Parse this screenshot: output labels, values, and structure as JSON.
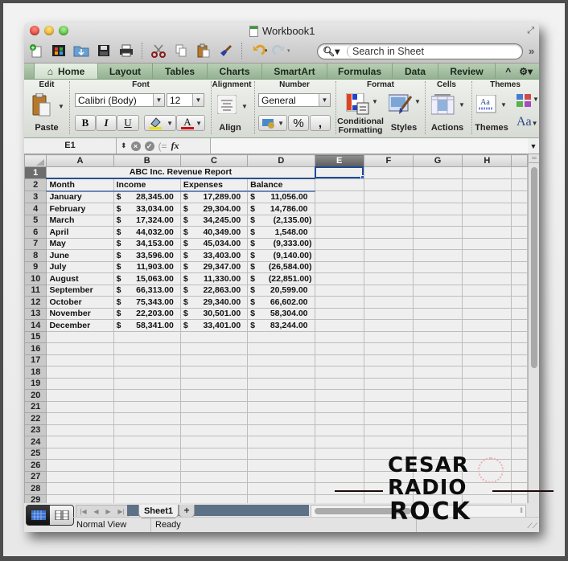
{
  "window": {
    "title": "Workbook1"
  },
  "toolbar": {
    "icons": [
      "new-workbook-icon",
      "gallery-icon",
      "open-icon",
      "save-icon",
      "print-icon",
      "cut-icon",
      "copy-icon",
      "paste-icon",
      "format-painter-icon",
      "undo-icon",
      "redo-icon"
    ],
    "search_placeholder": "Search in Sheet",
    "more": "»"
  },
  "ribbon_tabs": {
    "tabs": [
      "Home",
      "Layout",
      "Tables",
      "Charts",
      "SmartArt",
      "Formulas",
      "Data",
      "Review"
    ],
    "active": "Home",
    "collapse": "^",
    "gear": "⚙"
  },
  "ribbon": {
    "groups": {
      "edit": "Edit",
      "font": "Font",
      "alignment": "Alignment",
      "number": "Number",
      "format": "Format",
      "cells": "Cells",
      "themes": "Themes"
    },
    "paste_label": "Paste",
    "font_name": "Calibri (Body)",
    "font_size": "12",
    "bold": "B",
    "italic": "I",
    "underline": "U",
    "fill_color": "#f2e200",
    "font_color": "#d01010",
    "align_label": "Align",
    "number_format": "General",
    "percent": "%",
    "comma": ",",
    "conditional_formatting_1": "Conditional",
    "conditional_formatting_2": "Formatting",
    "styles_label": "Styles",
    "actions_label": "Actions",
    "themes_label": "Themes",
    "theme_fonts": "Aa"
  },
  "formula_bar": {
    "name_box": "E1",
    "fx": "fx",
    "value": ""
  },
  "sheet": {
    "columns": [
      "A",
      "B",
      "C",
      "D",
      "E",
      "F",
      "G",
      "H"
    ],
    "selected_column": "E",
    "selected_cell": "E1",
    "title": "ABC Inc. Revenue Report",
    "headers": [
      "Month",
      "Income",
      "Expenses",
      "Balance"
    ],
    "currency_symbol": "$",
    "rows": [
      {
        "month": "January",
        "income": "28,345.00",
        "expenses": "17,289.00",
        "balance": "11,056.00"
      },
      {
        "month": "February",
        "income": "33,034.00",
        "expenses": "29,304.00",
        "balance": "14,786.00"
      },
      {
        "month": "March",
        "income": "17,324.00",
        "expenses": "34,245.00",
        "balance": "(2,135.00)"
      },
      {
        "month": "April",
        "income": "44,032.00",
        "expenses": "40,349.00",
        "balance": "1,548.00"
      },
      {
        "month": "May",
        "income": "34,153.00",
        "expenses": "45,034.00",
        "balance": "(9,333.00)"
      },
      {
        "month": "June",
        "income": "33,596.00",
        "expenses": "33,403.00",
        "balance": "(9,140.00)"
      },
      {
        "month": "July",
        "income": "11,903.00",
        "expenses": "29,347.00",
        "balance": "(26,584.00)"
      },
      {
        "month": "August",
        "income": "15,063.00",
        "expenses": "11,330.00",
        "balance": "(22,851.00)"
      },
      {
        "month": "September",
        "income": "66,313.00",
        "expenses": "22,863.00",
        "balance": "20,599.00"
      },
      {
        "month": "October",
        "income": "75,343.00",
        "expenses": "29,340.00",
        "balance": "66,602.00"
      },
      {
        "month": "November",
        "income": "22,203.00",
        "expenses": "30,501.00",
        "balance": "58,304.00"
      },
      {
        "month": "December",
        "income": "58,341.00",
        "expenses": "33,401.00",
        "balance": "83,244.00"
      }
    ],
    "empty_row_numbers": [
      "15",
      "16",
      "17",
      "18",
      "19",
      "20",
      "21",
      "22",
      "23",
      "24",
      "25",
      "26",
      "27",
      "28",
      "29"
    ]
  },
  "bottom_bar": {
    "sheet_tab": "Sheet1",
    "add_sheet": "+",
    "view_mode": "Normal View",
    "status": "Ready"
  },
  "watermark": {
    "line1": "CESAR",
    "line2": "RADIO",
    "line3": "ROCK"
  }
}
